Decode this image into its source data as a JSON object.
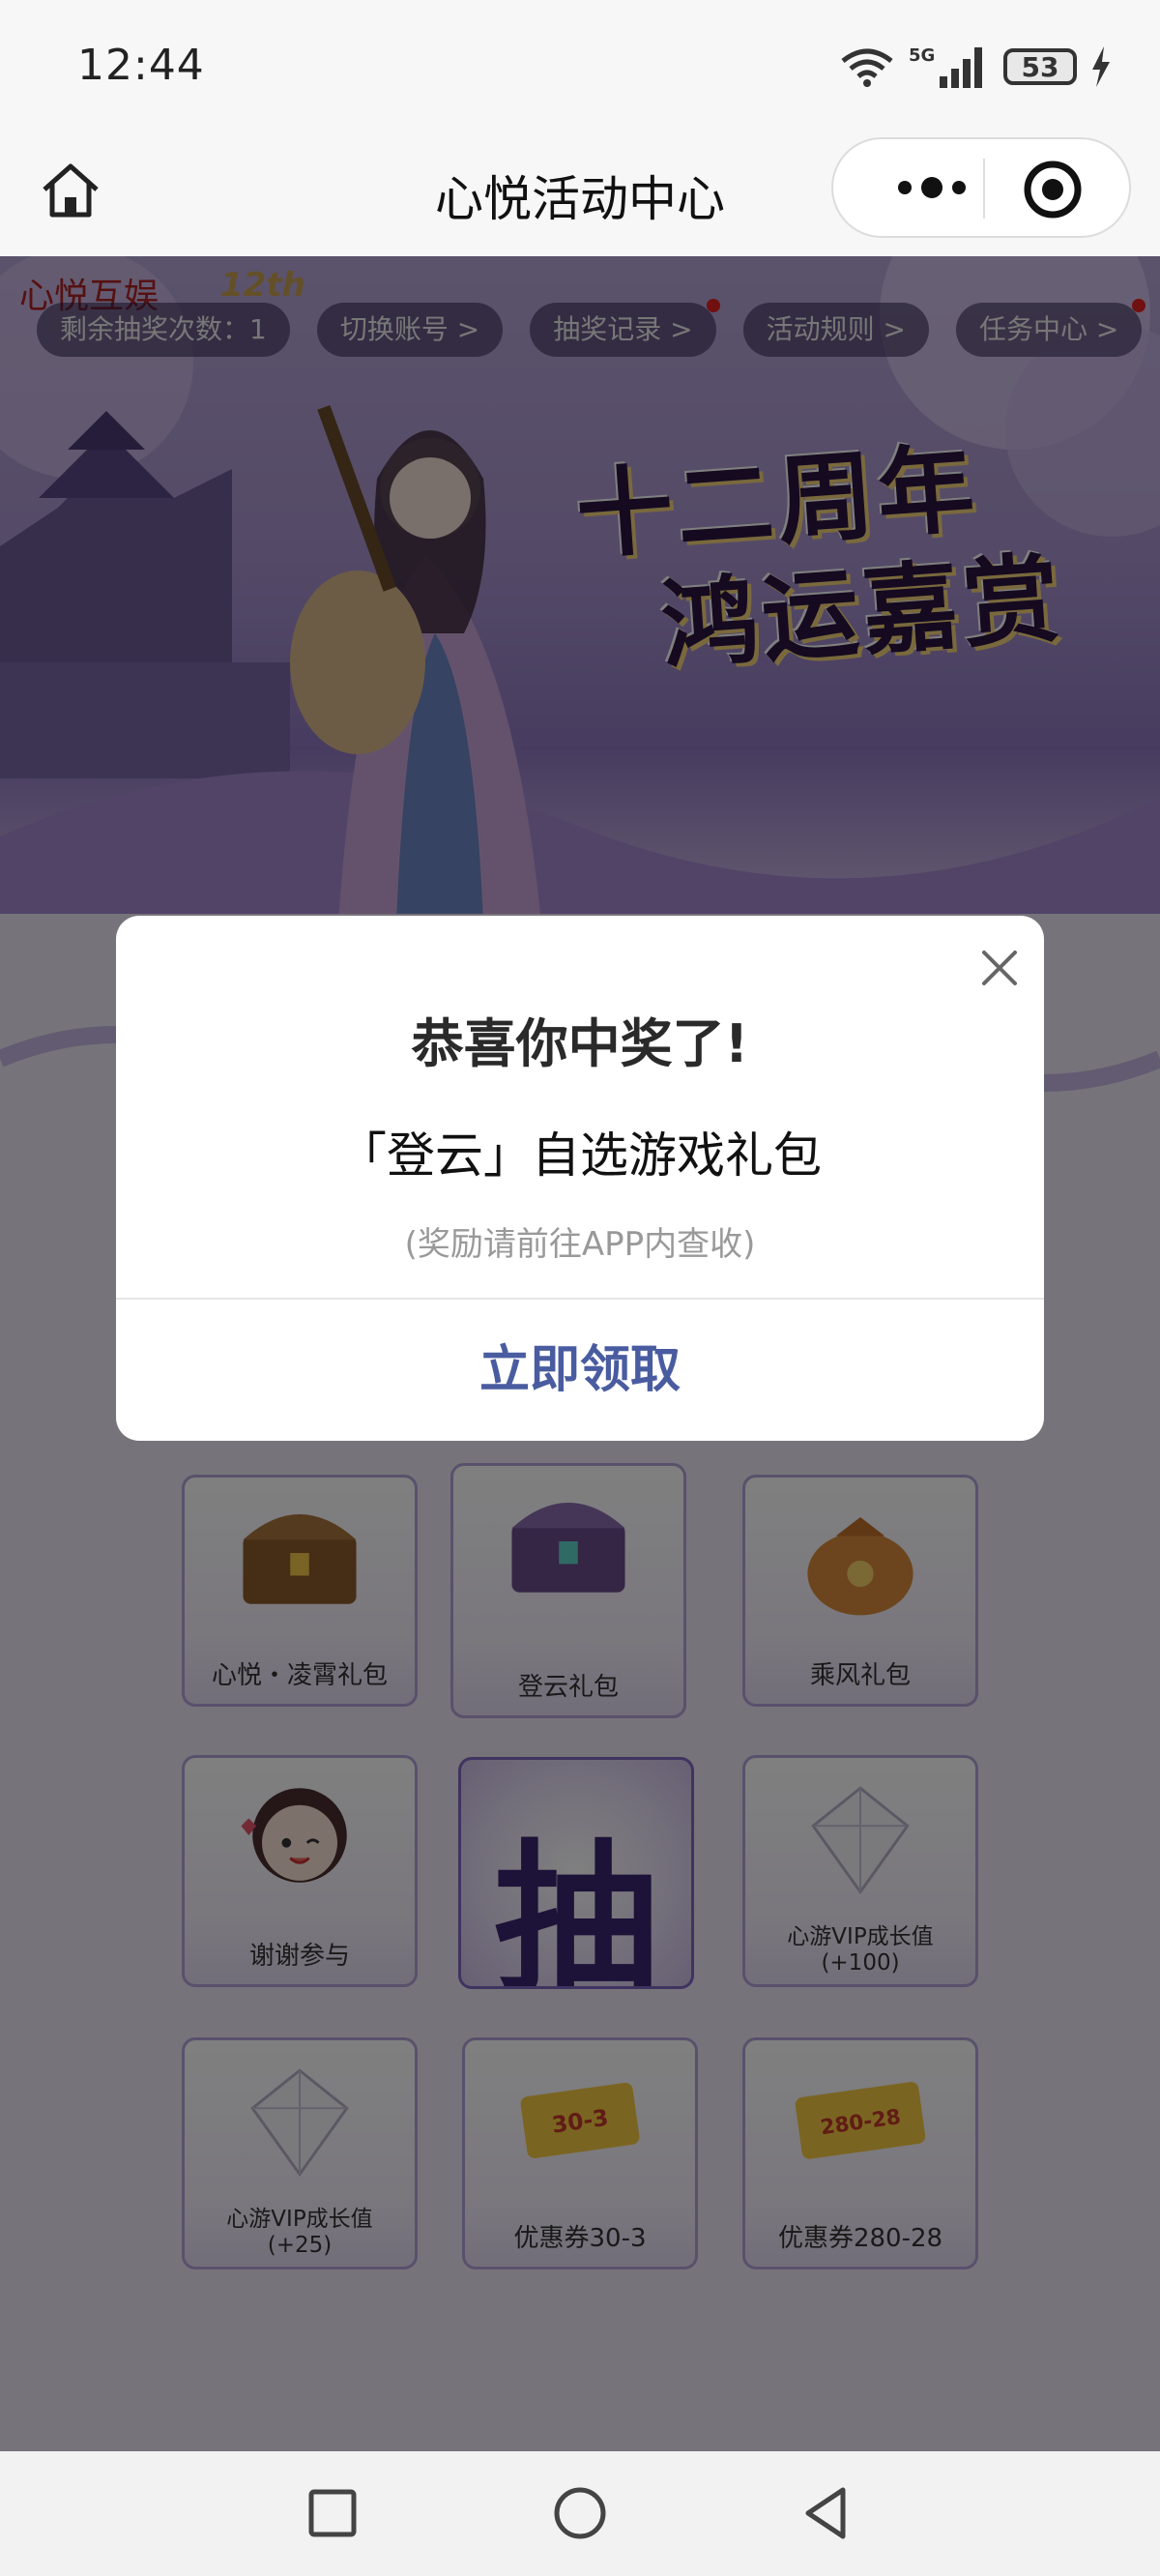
{
  "status_bar": {
    "time": "12:44",
    "network": "5G",
    "battery": "53"
  },
  "nav": {
    "title": "心悦活动中心"
  },
  "banner": {
    "logo": "心悦互娱",
    "logo_year": "12th",
    "slogan_line1": "十二周年",
    "slogan_line2": "鸿运嘉赏",
    "tabs": [
      {
        "label": "剩余抽奖次数：1",
        "dot": false
      },
      {
        "label": "切换账号 >",
        "dot": false
      },
      {
        "label": "抽奖记录 >",
        "dot": true
      },
      {
        "label": "活动规则 >",
        "dot": false
      },
      {
        "label": "任务中心 >",
        "dot": true
      }
    ]
  },
  "grid": {
    "items": [
      {
        "label": "心悦・凌霄礼包",
        "icon": "treasure-chest-gold"
      },
      {
        "label": "登云礼包",
        "icon": "treasure-chest-purple"
      },
      {
        "label": "乘风礼包",
        "icon": "lucky-bag"
      },
      {
        "label": "谢谢参与",
        "icon": "cartoon-girl"
      },
      {
        "label": "抽",
        "icon": "draw-button"
      },
      {
        "label": "心游VIP成长值\n(+100)",
        "icon": "crystal"
      },
      {
        "label": "心游VIP成长值\n(+25)",
        "icon": "crystal"
      },
      {
        "label": "优惠券30-3",
        "icon": "coupon",
        "coupon_text": "30-3"
      },
      {
        "label": "优惠券280-28",
        "icon": "coupon",
        "coupon_text": "280-28"
      }
    ]
  },
  "modal": {
    "title": "恭喜你中奖了!",
    "prize": "「登云」自选游戏礼包",
    "note": "(奖励请前往APP内查收)",
    "button": "立即领取"
  }
}
